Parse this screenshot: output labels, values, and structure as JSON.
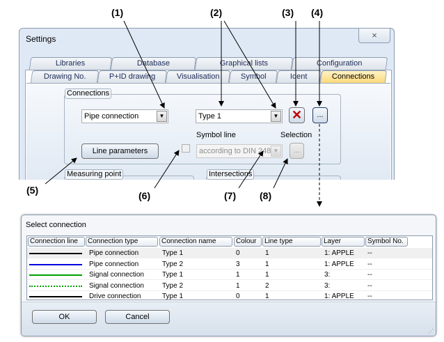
{
  "annotations": [
    "(1)",
    "(2)",
    "(3)",
    "(4)",
    "(5)",
    "(6)",
    "(7)",
    "(8)"
  ],
  "settings": {
    "title": "Settings",
    "close_icon": "×",
    "tabs_row1": [
      "Libraries",
      "Database",
      "Graphical lists",
      "Configuration"
    ],
    "tabs_row2": [
      "Drawing No.",
      "P+ID drawing",
      "Visualisation",
      "Symbol",
      "Ident",
      "Connections"
    ],
    "active_tab": "Connections",
    "connections_group": "Connections",
    "connection_type": "Pipe connection",
    "connection_name": "Type 1",
    "delete_icon": "red-x",
    "more_button": "...",
    "symbol_line_label": "Symbol line",
    "symbol_line_value": "according to DIN 2481",
    "selection_label": "Selection",
    "selection_button": "...",
    "line_parameters": "Line parameters",
    "symbol_line_checked": false,
    "measuring_point_group": "Measuring point",
    "intersections_group": "Intersections"
  },
  "select_dialog": {
    "title": "Select connection",
    "columns": [
      "Connection line",
      "Connection type",
      "Connection name",
      "Colour",
      "Line type",
      "Layer",
      "Symbol No."
    ],
    "rows": [
      {
        "line_color": "#000000",
        "line_style": "solid",
        "type": "Pipe connection",
        "name": "Type 1",
        "colour": "0",
        "line_type": "1",
        "layer": "1: APPLE",
        "symbol": "--"
      },
      {
        "line_color": "#0000e0",
        "line_style": "solid",
        "type": "Pipe connection",
        "name": "Type 2",
        "colour": "3",
        "line_type": "1",
        "layer": "1: APPLE",
        "symbol": "--"
      },
      {
        "line_color": "#00a000",
        "line_style": "solid",
        "type": "Signal connection",
        "name": "Type 1",
        "colour": "1",
        "line_type": "1",
        "layer": "3:",
        "symbol": "--"
      },
      {
        "line_color": "#00a000",
        "line_style": "dotted",
        "type": "Signal connection",
        "name": "Type 2",
        "colour": "1",
        "line_type": "2",
        "layer": "3:",
        "symbol": "--"
      },
      {
        "line_color": "#000000",
        "line_style": "solid",
        "type": "Drive connection",
        "name": "Type 1",
        "colour": "0",
        "line_type": "1",
        "layer": "1: APPLE",
        "symbol": "--"
      }
    ],
    "ok": "OK",
    "cancel": "Cancel"
  }
}
